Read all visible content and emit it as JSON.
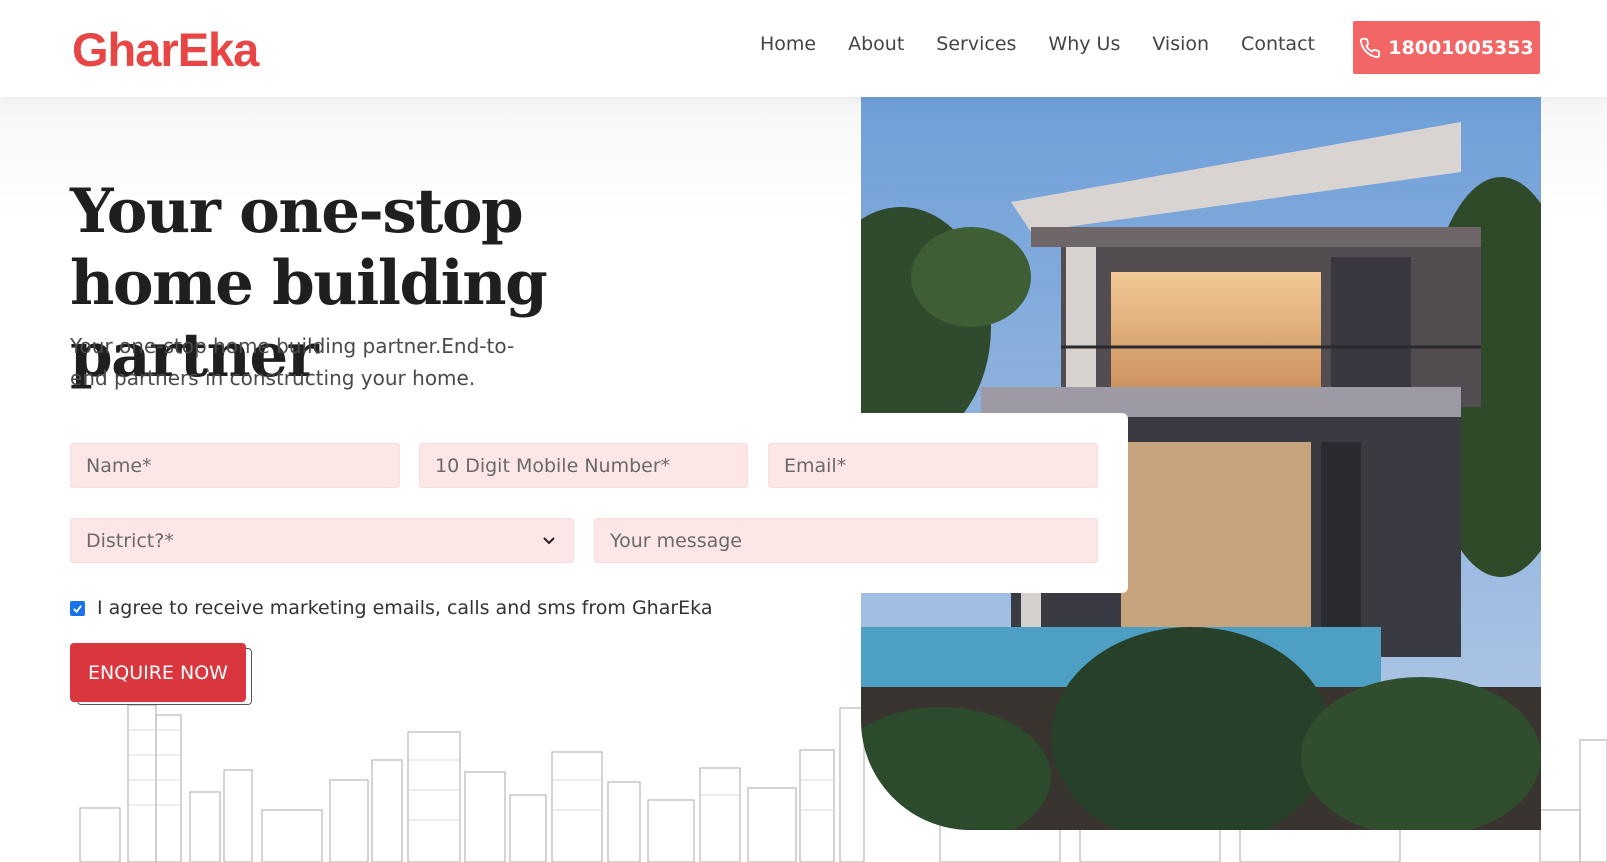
{
  "brand": {
    "logo": "GharEka",
    "accent": "#e84545",
    "button_color": "#f26666",
    "cta_color": "#d9363e"
  },
  "nav": {
    "items": [
      "Home",
      "About",
      "Services",
      "Why Us",
      "Vision",
      "Contact"
    ]
  },
  "header": {
    "phone": "18001005353",
    "phone_icon": "phone-icon"
  },
  "hero": {
    "title": "Your one-stop home building partner",
    "subtitle": "Your one-stop home building partner.End-to-end partners in constructing your home."
  },
  "form": {
    "name_placeholder": "Name*",
    "mobile_placeholder": "10 Digit Mobile Number*",
    "email_placeholder": "Email*",
    "district_placeholder": "District?*",
    "message_placeholder": "Your message",
    "consent_label": "I agree to receive marketing emails, calls and sms from GharEka",
    "consent_checked": true,
    "submit_label": "ENQUIRE NOW",
    "field_bg": "#fde6e6"
  }
}
